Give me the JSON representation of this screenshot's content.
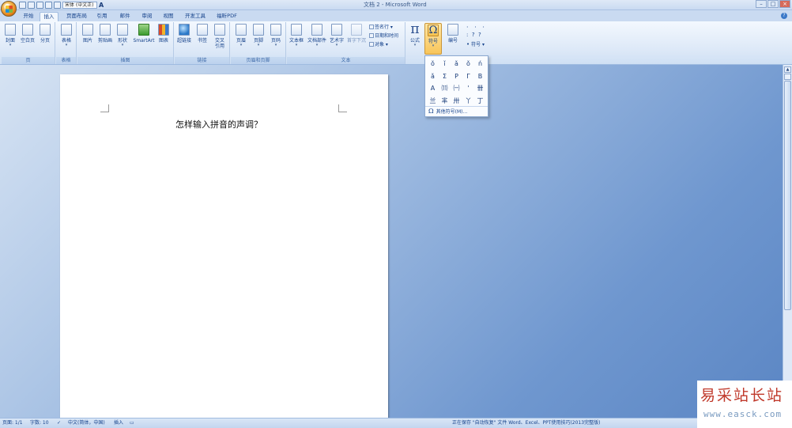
{
  "titlebar": {
    "title": "文档 2 - Microsoft Word",
    "font_name": "宋体 (中文正)",
    "font_a": "A",
    "window_buttons": [
      "–",
      "□",
      "×"
    ]
  },
  "tabs": [
    {
      "label": "开始"
    },
    {
      "label": "插入"
    },
    {
      "label": "页面布局"
    },
    {
      "label": "引用"
    },
    {
      "label": "邮件"
    },
    {
      "label": "审阅"
    },
    {
      "label": "视图"
    },
    {
      "label": "开发工具"
    },
    {
      "label": "福昕PDF"
    }
  ],
  "help_label": "?",
  "ribbon": {
    "groups": {
      "page": "页",
      "table": "表格",
      "illustrations": "插图",
      "links": "链接",
      "header_footer": "页眉和页脚",
      "text": "文本"
    },
    "buttons": {
      "cover": "封面",
      "blank_page": "空白页",
      "page_break": "分页",
      "table": "表格",
      "picture": "图片",
      "clip_art": "剪贴画",
      "shapes": "形状",
      "smartart": "SmartArt",
      "chart": "图表",
      "hyperlink": "超链接",
      "bookmark": "书签",
      "cross_ref_1": "交叉",
      "cross_ref_2": "引用",
      "header": "页眉",
      "footer": "页脚",
      "page_number": "页码",
      "text_box": "文本框",
      "quick_parts": "文档部件",
      "wordart": "艺术字",
      "drop_cap": "首字下沉",
      "signature_line": "签名行",
      "date_time": "日期和时间",
      "object": "对象",
      "equation": "公式",
      "symbol": "符号",
      "numbering": "编号",
      "symbol_small": "符号"
    },
    "equation_glyph": "π",
    "symbol_glyph": "Ω",
    "small_syms": [
      "·",
      "·",
      "·",
      ":",
      "?",
      "?"
    ]
  },
  "document": {
    "text": "怎样输入拼音的声调？"
  },
  "symbol_dropdown": {
    "symbols": [
      "ǒ",
      "ǐ",
      "ǎ",
      "ǒ",
      "ń",
      "ǎ",
      "Σ",
      "P",
      "Γ",
      "B",
      "A",
      "⑾",
      "㈠",
      "'",
      "卌",
      "兰",
      "芈",
      "卅",
      "丫",
      "丁"
    ],
    "more_label": "其他符号(M)...",
    "more_glyph": "Ω"
  },
  "statusbar": {
    "page": "页面: 1/1",
    "words": "字数: 10",
    "language": "中文(简体，中国)",
    "mode": "插入",
    "autosave": "正在保存 \"自动恢复\" 文件 Word、Excel、PPT使用技巧(2013完整版)"
  },
  "watermark": {
    "title": "易采站长站",
    "url": "www.easck.com"
  }
}
